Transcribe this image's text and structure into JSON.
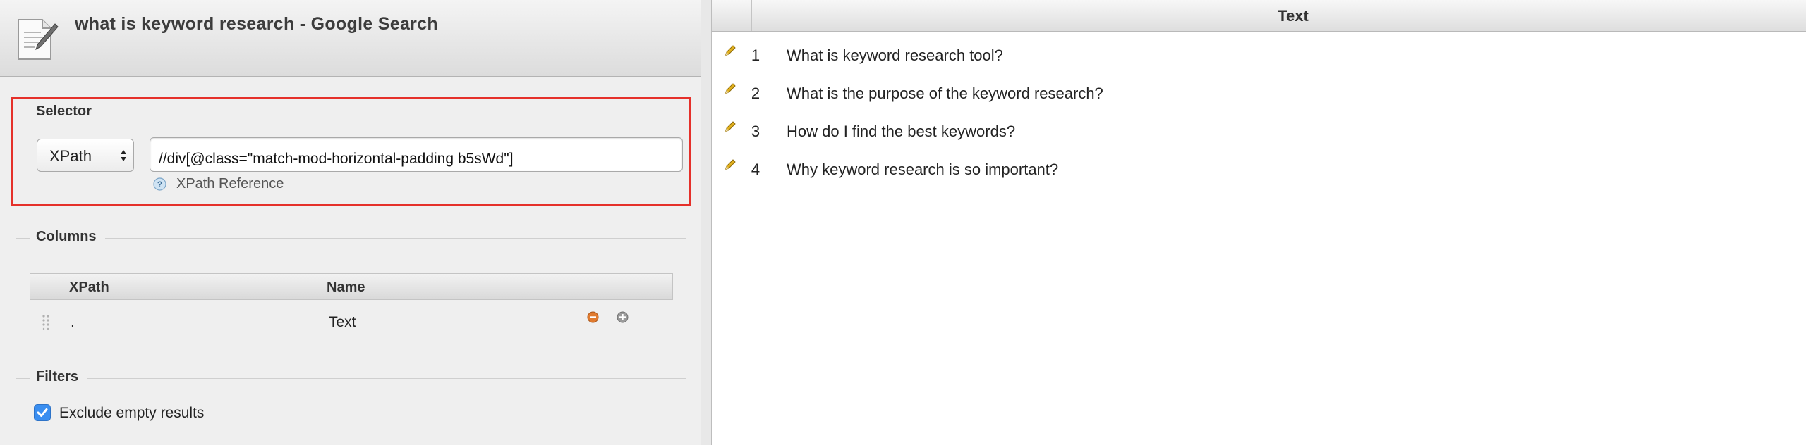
{
  "window": {
    "title": "what is keyword research - Google Search"
  },
  "selector": {
    "legend": "Selector",
    "type_value": "XPath",
    "expression": "//div[@class=\"match-mod-horizontal-padding b5sWd\"]",
    "reference_link": "XPath Reference"
  },
  "columns": {
    "legend": "Columns",
    "headers": [
      "XPath",
      "Name"
    ],
    "rows": [
      {
        "xpath": ".",
        "name": "Text"
      }
    ]
  },
  "filters": {
    "legend": "Filters",
    "exclude_empty_label": "Exclude empty results",
    "exclude_empty_checked": true
  },
  "results": {
    "column_header": "Text",
    "rows": [
      {
        "num": "1",
        "text": "What is keyword research tool?"
      },
      {
        "num": "2",
        "text": "What is the purpose of the keyword research?"
      },
      {
        "num": "3",
        "text": "How do I find the best keywords?"
      },
      {
        "num": "4",
        "text": "Why keyword research is so important?"
      }
    ]
  },
  "colors": {
    "highlight_border": "#e5302a",
    "checkbox": "#3a8ef0"
  },
  "icons": [
    "document-edit-icon",
    "select-arrows-icon",
    "help-icon",
    "drag-handle-icon",
    "remove-icon",
    "add-icon",
    "checkmark-icon",
    "pencil-icon"
  ]
}
